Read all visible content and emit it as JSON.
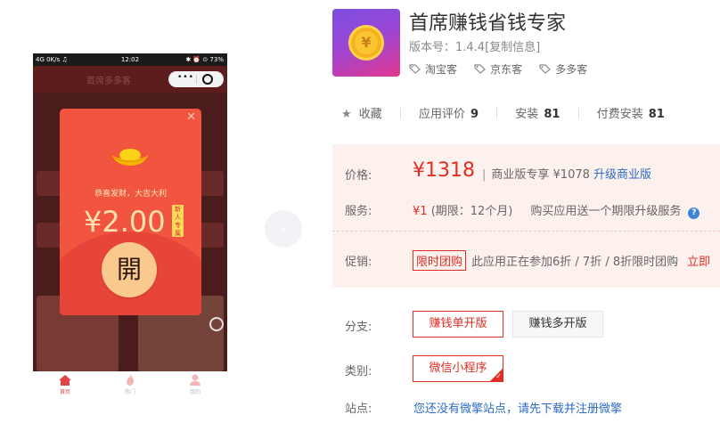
{
  "preview": {
    "status": {
      "left": "4G 0K/s ♫",
      "time": "12:02",
      "right": "✱ ⏰ ⊙ 73%"
    },
    "header_title": "首席多多客",
    "packet": {
      "greeting": "恭喜发财，大吉大利",
      "amount": "¥2.00",
      "badge": "新人专属",
      "open_label": "開"
    },
    "tabs": [
      {
        "label": "首页",
        "icon": "home-icon"
      },
      {
        "label": "热门",
        "icon": "flame-icon"
      },
      {
        "label": "我的",
        "icon": "user-icon"
      }
    ]
  },
  "app": {
    "title": "首席赚钱省钱专家",
    "version_label": "版本号：1.4.4",
    "version_link": "[复制信息]",
    "tags": [
      "淘宝客",
      "京东客",
      "多多客"
    ]
  },
  "stats": {
    "favorite": "收藏",
    "rating_label": "应用评价",
    "rating_value": "9",
    "install_label": "安装",
    "install_value": "81",
    "paid_label": "付费安装",
    "paid_value": "81"
  },
  "pricing": {
    "price_label": "价格:",
    "price": "¥1318",
    "pro_text": "商业版专享 ¥1078",
    "upgrade_link": "升级商业版",
    "service_label": "服务:",
    "service_price": "¥1",
    "service_period": "(期限：12个月)",
    "service_note": "购买应用送一个期限升级服务",
    "promo_label": "促销:",
    "promo_tag": "限时团购",
    "promo_text": "此应用正在参加6折 / 7折 / 8折限时团购",
    "promo_link": "立即"
  },
  "branch": {
    "label": "分支:",
    "options": [
      "赚钱单开版",
      "赚钱多开版"
    ]
  },
  "category": {
    "label": "类别:",
    "value": "微信小程序"
  },
  "site": {
    "label": "站点:",
    "text": "您还没有微擎站点，请先下载并注册微擎"
  },
  "colors": {
    "accent_red": "#e02e24",
    "link_blue": "#2c6cc4",
    "packet_red": "#f2553f",
    "price_bg": "#fdf1ee"
  }
}
